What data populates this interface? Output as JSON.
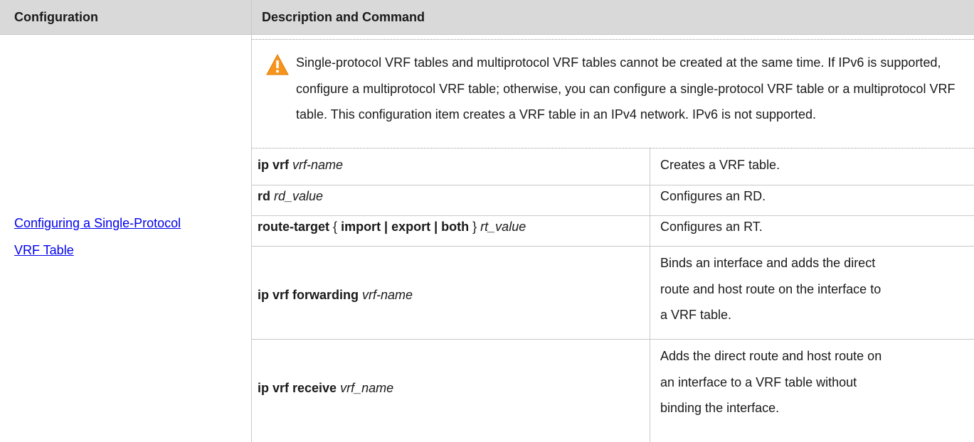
{
  "table": {
    "headers": {
      "configuration": "Configuration",
      "description": "Description and Command"
    },
    "configuration_link": {
      "line1": "Configuring a Single-Protocol",
      "line2": "VRF Table"
    },
    "note": {
      "icon": "warning-triangle-icon",
      "icon_color": "#f7941d",
      "text": "Single-protocol VRF tables and multiprotocol VRF tables cannot be created at the same time. If IPv6 is supported, configure a multiprotocol VRF table; otherwise, you can configure a single-protocol VRF table or a multiprotocol VRF table. This configuration item creates a VRF table in an IPv4 network. IPv6 is not supported."
    },
    "rows": [
      {
        "cmd_bold": "ip vrf",
        "cmd_italic": "vrf-name",
        "description": "Creates a VRF table."
      },
      {
        "cmd_bold": "rd",
        "cmd_italic": "rd_value",
        "description": "Configures an RD."
      },
      {
        "cmd_parts": {
          "p1": "route-target",
          "p2": "{",
          "p3": "import | export | both",
          "p4": "}",
          "p5": "rt_value"
        },
        "description": "Configures an RT."
      },
      {
        "cmd_bold": "ip vrf forwarding",
        "cmd_italic": "vrf-name",
        "description_lines": [
          "Binds an interface and adds the direct",
          "route and host route on the interface to",
          "a VRF table."
        ]
      },
      {
        "cmd_bold": "ip vrf receive",
        "cmd_italic": "vrf_name",
        "description_lines": [
          "Adds the direct route and host route on",
          "an interface to a VRF table without",
          "binding the interface."
        ]
      }
    ],
    "colors": {
      "header_bg": "#d9d9d9",
      "link": "#0000ee",
      "border": "#c8c8c8"
    }
  }
}
